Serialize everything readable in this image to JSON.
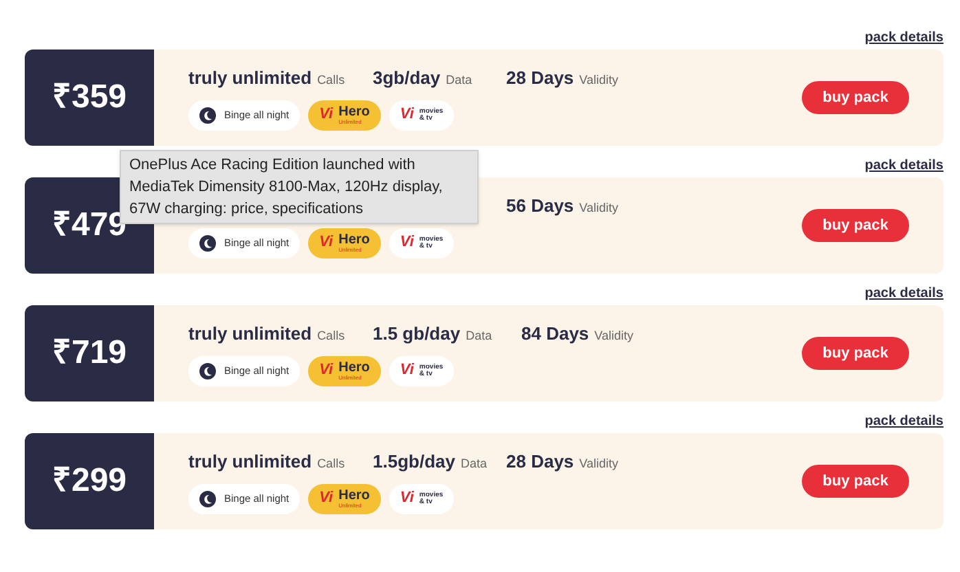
{
  "plans": [
    {
      "link": "pack details",
      "price": "₹359",
      "calls": {
        "value": "truly unlimited",
        "label": "Calls"
      },
      "data": {
        "value": "3gb/day",
        "label": "Data"
      },
      "validity": {
        "value": "28 Days",
        "label": "Validity"
      },
      "badges": [
        {
          "kind": "binge",
          "text": "Binge all night"
        },
        {
          "kind": "hero",
          "logo": "Vi",
          "text": "Hero",
          "sub": "Unlimited"
        },
        {
          "kind": "movies",
          "logo": "Vi",
          "text": "movies",
          "sub": "& tv"
        }
      ],
      "button": "buy pack"
    },
    {
      "link": "pack details",
      "price": "₹479",
      "validity": {
        "value": "56 Days",
        "label": "Validity"
      },
      "badges": [
        {
          "kind": "binge",
          "text": "Binge all night"
        },
        {
          "kind": "hero",
          "logo": "Vi",
          "text": "Hero",
          "sub": "Unlimited"
        },
        {
          "kind": "movies",
          "logo": "Vi",
          "text": "movies",
          "sub": "& tv"
        }
      ],
      "button": "buy pack"
    },
    {
      "link": "pack details",
      "price": "₹719",
      "calls": {
        "value": "truly unlimited",
        "label": "Calls"
      },
      "data": {
        "value": "1.5 gb/day",
        "label": "Data"
      },
      "validity": {
        "value": "84 Days",
        "label": "Validity"
      },
      "badges": [
        {
          "kind": "binge",
          "text": "Binge all night"
        },
        {
          "kind": "hero",
          "logo": "Vi",
          "text": "Hero",
          "sub": "Unlimited"
        },
        {
          "kind": "movies",
          "logo": "Vi",
          "text": "movies",
          "sub": "& tv"
        }
      ],
      "button": "buy pack"
    },
    {
      "link": "pack details",
      "price": "₹299",
      "calls": {
        "value": "truly unlimited",
        "label": "Calls"
      },
      "data": {
        "value": "1.5gb/day",
        "label": "Data"
      },
      "validity": {
        "value": "28 Days",
        "label": "Validity"
      },
      "badges": [
        {
          "kind": "binge",
          "text": "Binge all night"
        },
        {
          "kind": "hero",
          "logo": "Vi",
          "text": "Hero",
          "sub": "Unlimited"
        },
        {
          "kind": "movies",
          "logo": "Vi",
          "text": "movies",
          "sub": "& tv"
        }
      ],
      "button": "buy pack"
    }
  ],
  "tooltip": {
    "text": "OnePlus Ace Racing Edition launched with MediaTek Dimensity 8100-Max, 120Hz display, 67W charging: price, specifications"
  }
}
